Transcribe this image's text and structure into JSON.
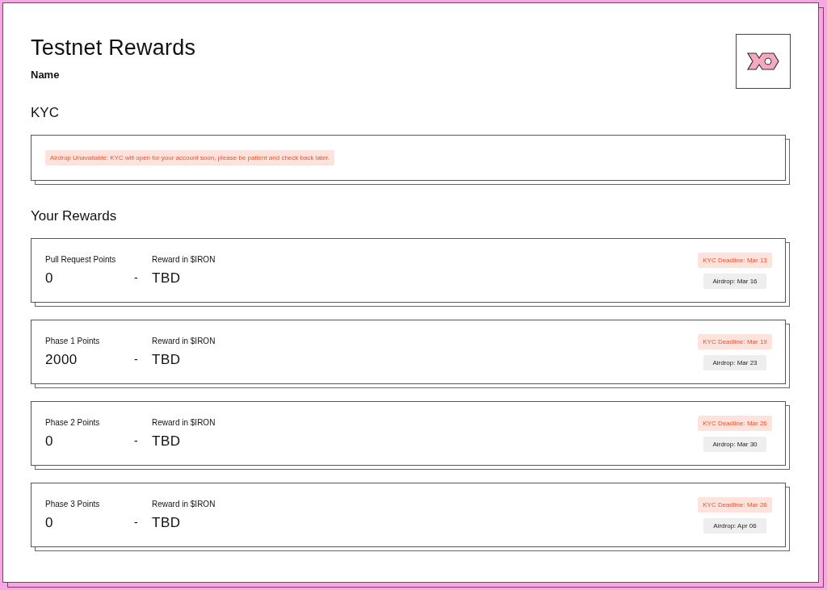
{
  "title": "Testnet Rewards",
  "subtitle": "Name",
  "kyc": {
    "heading": "KYC",
    "notice": "Airdrop Unavailable: KYC will open for your account soon, please be patient and check back later."
  },
  "rewards": {
    "heading": "Your Rewards",
    "items": [
      {
        "points_label": "Pull Request Points",
        "points": "0",
        "separator": "-",
        "reward_label": "Reward in $IRON",
        "reward": "TBD",
        "deadline": "KYC Deadline: Mar 13",
        "airdrop": "Airdrop: Mar 16"
      },
      {
        "points_label": "Phase 1 Points",
        "points": "2000",
        "separator": "-",
        "reward_label": "Reward in $IRON",
        "reward": "TBD",
        "deadline": "KYC Deadline: Mar 19",
        "airdrop": "Airdrop: Mar 23"
      },
      {
        "points_label": "Phase 2 Points",
        "points": "0",
        "separator": "-",
        "reward_label": "Reward in $IRON",
        "reward": "TBD",
        "deadline": "KYC Deadline: Mar 26",
        "airdrop": "Airdrop: Mar 30"
      },
      {
        "points_label": "Phase 3 Points",
        "points": "0",
        "separator": "-",
        "reward_label": "Reward in $IRON",
        "reward": "TBD",
        "deadline": "KYC Deadline: Mar 26",
        "airdrop": "Airdrop: Apr 06"
      }
    ]
  }
}
